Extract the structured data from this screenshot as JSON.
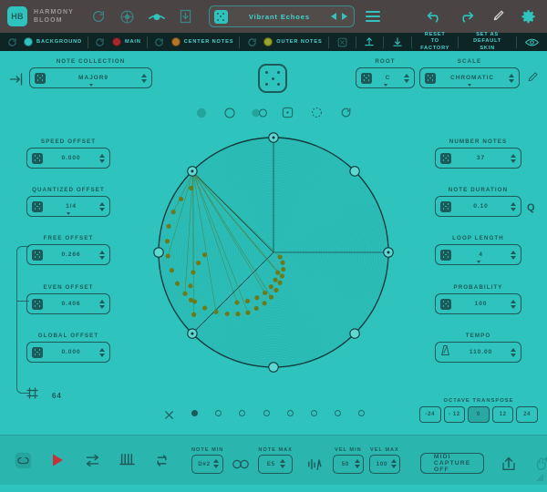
{
  "app": {
    "logo_initials": "HB",
    "logo_line1": "HARMONY",
    "logo_line2": "BLOOM"
  },
  "toolbar": {
    "icons": [
      {
        "name": "refresh-icon",
        "label": "Refresh"
      },
      {
        "name": "target-icon",
        "label": "Target"
      },
      {
        "name": "cloud-icon",
        "label": "Cloud"
      },
      {
        "name": "save-download-icon",
        "label": "Save"
      }
    ],
    "preset": {
      "name": "Vibrant Echoes",
      "dice_icon": "dice-icon",
      "prev_icon": "prev-arrow-icon",
      "next_icon": "next-arrow-icon"
    },
    "menu_icon": "hamburger-menu-icon",
    "undo_icon": "undo-icon",
    "redo_icon": "redo-icon",
    "brush_icon": "paintbrush-icon",
    "settings_icon": "gear-icon"
  },
  "colorbar": {
    "items": [
      {
        "label": "BACKGROUND",
        "color": "#2ec4bd"
      },
      {
        "label": "MAIN",
        "color": "#a8272f"
      },
      {
        "label": "CENTER NOTES",
        "color": "#b57628"
      },
      {
        "label": "OUTER NOTES",
        "color": "#97a52a"
      }
    ],
    "buttons": [
      {
        "name": "pattern-icon",
        "line1": "",
        "line2": ""
      },
      {
        "name": "upload-icon",
        "line1": "",
        "line2": ""
      },
      {
        "name": "download-icon",
        "line1": "",
        "line2": ""
      },
      {
        "name": "reset-to-factory-button",
        "line1": "RESET TO",
        "line2": "FACTORY"
      },
      {
        "name": "set-as-default-skin-button",
        "line1": "SET AS",
        "line2": "DEFAULT SKIN"
      },
      {
        "name": "eye-icon",
        "line1": "",
        "line2": ""
      }
    ]
  },
  "header_controls": {
    "note_collection": {
      "label": "NOTE COLLECTION",
      "value": "MAJOR9"
    },
    "root": {
      "label": "ROOT",
      "value": "C"
    },
    "scale": {
      "label": "SCALE",
      "value": "CHROMATIC"
    },
    "edit_icon": "pencil-icon",
    "enter_icon": "enter-arrow-icon"
  },
  "left_controls": [
    {
      "label": "SPEED OFFSET",
      "value": "0.000",
      "has_caret": false
    },
    {
      "label": "QUANTIZED OFFSET",
      "value": "1/4",
      "has_caret": true
    },
    {
      "label": "FREE OFFSET",
      "value": "0.266",
      "has_caret": false
    },
    {
      "label": "EVEN OFFSET",
      "value": "0.406",
      "has_caret": false
    },
    {
      "label": "GLOBAL OFFSET",
      "value": "0.000",
      "has_caret": false
    }
  ],
  "right_controls": [
    {
      "label": "NUMBER NOTES",
      "value": "37",
      "has_caret": false,
      "suffix": ""
    },
    {
      "label": "NOTE DURATION",
      "value": "0.10",
      "has_caret": false,
      "suffix": "Q"
    },
    {
      "label": "LOOP LENGTH",
      "value": "4",
      "has_caret": true,
      "suffix": ""
    },
    {
      "label": "PROBABILITY",
      "value": "100",
      "has_caret": false,
      "suffix": ""
    },
    {
      "label": "TEMPO",
      "value": "110.00",
      "has_caret": false,
      "suffix": "",
      "icon": "metronome-icon"
    }
  ],
  "center": {
    "randomize_icon": "dice-large-icon",
    "modes": [
      {
        "name": "mode-filled-circle-icon",
        "active": true
      },
      {
        "name": "mode-hollow-circle-icon",
        "active": false
      },
      {
        "name": "mode-double-circle-icon",
        "active": false
      },
      {
        "name": "mode-square-dot-icon",
        "active": false
      },
      {
        "name": "mode-dashed-circle-icon",
        "active": false
      },
      {
        "name": "mode-undo-icon",
        "active": false
      }
    ],
    "pager": {
      "clear_icon": "close-x-icon",
      "dots": [
        true,
        false,
        false,
        false,
        false,
        false,
        false,
        false
      ]
    },
    "frame": {
      "icon": "frame-grid-icon",
      "value": "64"
    }
  },
  "octave": {
    "label": "OCTAVE TRANSPOSE",
    "options": [
      "-24",
      "- 12",
      "0",
      "12",
      "24"
    ],
    "selected_index": 2
  },
  "bottombar": {
    "icons": [
      {
        "name": "link-sync-icon"
      },
      {
        "name": "play-icon"
      },
      {
        "name": "shuffle-icon"
      },
      {
        "name": "keyboard-icon"
      },
      {
        "name": "loop-repeat-icon"
      }
    ],
    "note_min": {
      "label": "NOTE MIN",
      "value": "D#2"
    },
    "link_icon": "chain-link-icon",
    "note_max": {
      "label": "NOTE MAX",
      "value": "E5"
    },
    "wave_icon": "waveform-icon",
    "vel_min": {
      "label": "VEL MIN",
      "value": "50"
    },
    "vel_max": {
      "label": "VEL MAX",
      "value": "100"
    },
    "midi_capture": {
      "label": "MIDI CAPTURE OFF"
    },
    "export_icon": "export-up-icon",
    "magic_icon": "magic-hand-icon"
  },
  "visualization": {
    "node_handles": [
      {
        "angle": -90,
        "selected": true
      },
      {
        "angle": -135,
        "selected": true
      },
      {
        "angle": 180,
        "selected": false
      },
      {
        "angle": 135,
        "selected": true
      },
      {
        "angle": 90,
        "selected": false
      },
      {
        "angle": 45,
        "selected": false
      },
      {
        "angle": 0,
        "selected": true
      },
      {
        "angle": -45,
        "selected": false
      }
    ],
    "spokes": [
      -90,
      -135,
      135,
      0
    ],
    "note_dots": [
      [
        0.07,
        35
      ],
      [
        0.12,
        48
      ],
      [
        0.17,
        60
      ],
      [
        0.22,
        70
      ],
      [
        0.27,
        78
      ],
      [
        0.33,
        86
      ],
      [
        0.39,
        93
      ],
      [
        0.45,
        100
      ],
      [
        0.51,
        107
      ],
      [
        0.57,
        113
      ],
      [
        0.62,
        120
      ],
      [
        0.67,
        127
      ],
      [
        0.72,
        134
      ],
      [
        0.77,
        141
      ],
      [
        0.81,
        148
      ],
      [
        0.85,
        155
      ],
      [
        0.88,
        162
      ],
      [
        0.9,
        170
      ],
      [
        0.92,
        178
      ],
      [
        0.93,
        186
      ],
      [
        0.94,
        194
      ],
      [
        0.94,
        202
      ],
      [
        0.93,
        210
      ],
      [
        0.91,
        218
      ],
      [
        0.88,
        142
      ],
      [
        0.83,
        150
      ],
      [
        0.78,
        158
      ],
      [
        0.72,
        166
      ],
      [
        0.66,
        172
      ],
      [
        0.6,
        178
      ],
      [
        0.54,
        126
      ],
      [
        0.48,
        118
      ],
      [
        0.42,
        110
      ],
      [
        0.36,
        102
      ],
      [
        0.3,
        94
      ],
      [
        0.24,
        86
      ],
      [
        0.18,
        78
      ]
    ],
    "dot_color": "#6e7a18",
    "ring_color": "#25a39d",
    "outline_color": "#123b3d"
  }
}
